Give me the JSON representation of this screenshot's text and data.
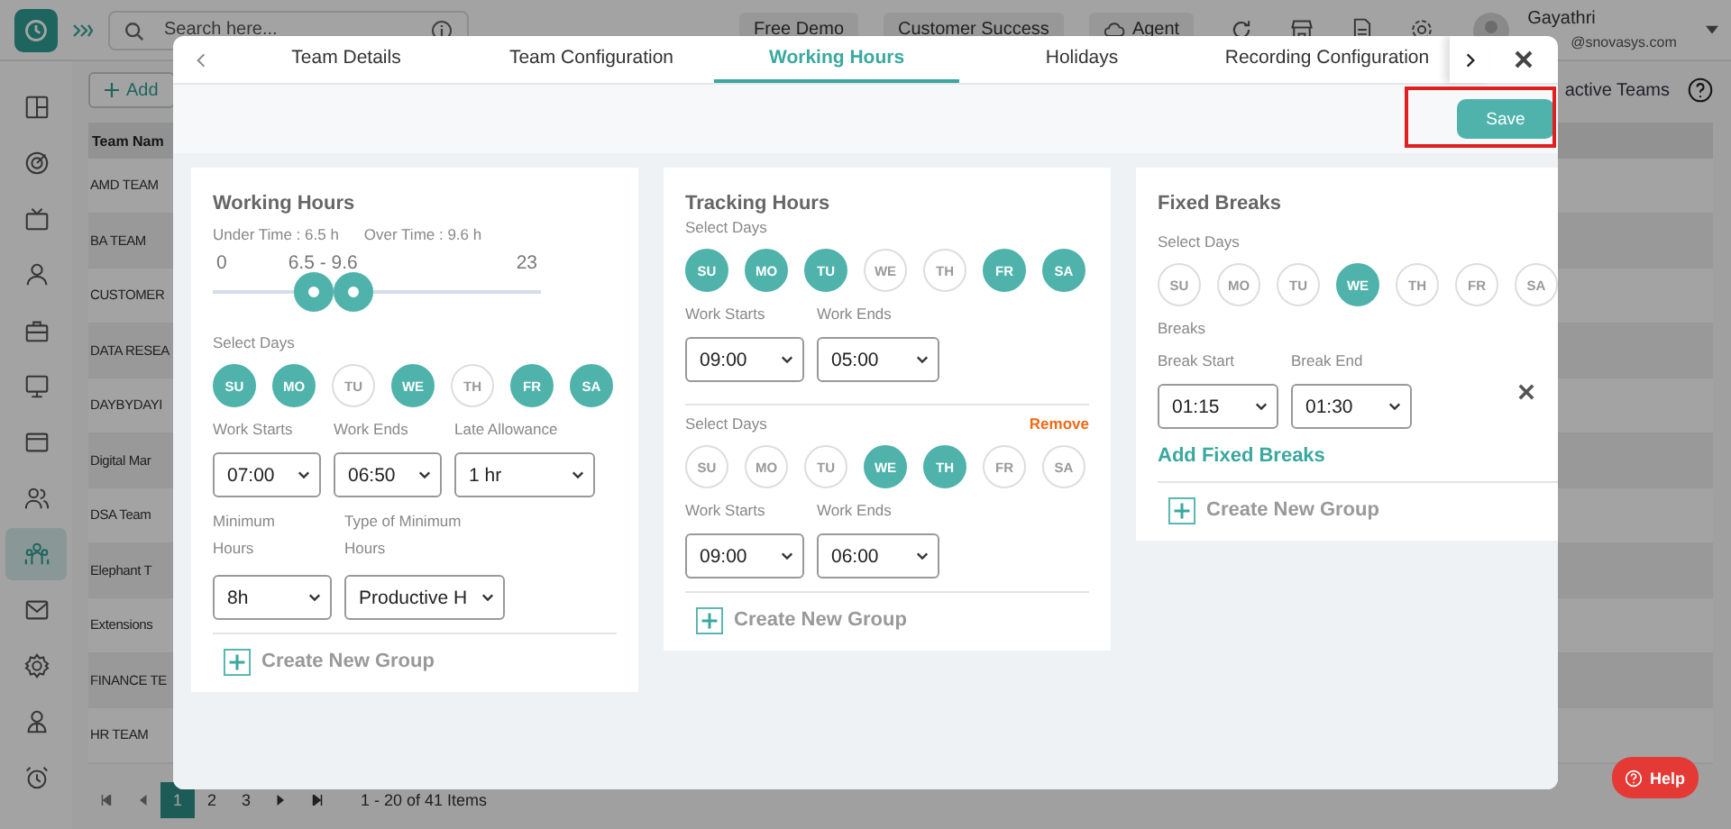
{
  "header": {
    "search": {
      "placeholder": "Search here..."
    },
    "buttons": [
      {
        "label": "Free Demo",
        "kind": "plain"
      },
      {
        "label": "Customer Success",
        "kind": "plain"
      },
      {
        "label": "Agent",
        "kind": "cloud"
      }
    ],
    "user": {
      "name": "Gayathri",
      "email": "@snovasys.com"
    }
  },
  "sidebar": {
    "items": [
      {
        "selected": false
      },
      {
        "selected": false
      },
      {
        "selected": false
      },
      {
        "selected": false
      },
      {
        "selected": false
      },
      {
        "selected": false
      },
      {
        "selected": false
      },
      {
        "selected": false
      },
      {
        "selected": true
      },
      {
        "selected": false
      },
      {
        "selected": false
      },
      {
        "selected": false
      },
      {
        "selected": false
      }
    ]
  },
  "page": {
    "add_button": "Add",
    "link": "active Teams",
    "table": {
      "columns": [
        "Team Nam"
      ],
      "rows": [
        "AMD TEAM",
        "BA TEAM",
        "CUSTOMER",
        "DATA RESEA",
        "DAYBYDAYI",
        "Digital Mar",
        "DSA Team",
        "Elephant T",
        "Extensions",
        "FINANCE TE",
        "HR TEAM"
      ]
    },
    "pagination": {
      "pages": [
        {
          "label": "1",
          "selected": true
        },
        {
          "label": "2",
          "selected": false
        },
        {
          "label": "3",
          "selected": false
        }
      ],
      "summary": "1 - 20 of 41 Items"
    }
  },
  "help_button": "Help",
  "modal": {
    "tabs": [
      {
        "label": "Team Details",
        "selected": false
      },
      {
        "label": "Team Configuration",
        "selected": false
      },
      {
        "label": "Working Hours",
        "selected": true
      },
      {
        "label": "Holidays",
        "selected": false
      },
      {
        "label": "Recording Configuration",
        "selected": false
      }
    ],
    "save_button": {
      "label": "Save",
      "highlighted": true
    },
    "cards": [
      {
        "title": "Working Hours",
        "times": [
          "Under Time : 6.5 h",
          "Over Time : 9.6 h"
        ],
        "slider": {
          "min": "0",
          "range": "6.5 - 9.6",
          "max": "23",
          "thumbs": [
            {
              "level": 0.31
            },
            {
              "level": 0.43
            }
          ]
        },
        "groups": [
          {
            "days_label": "Select Days",
            "days": [
              {
                "label": "SU",
                "selected": true
              },
              {
                "label": "MO",
                "selected": true
              },
              {
                "label": "TU",
                "selected": false
              },
              {
                "label": "WE",
                "selected": true
              },
              {
                "label": "TH",
                "selected": false
              },
              {
                "label": "FR",
                "selected": true
              },
              {
                "label": "SA",
                "selected": true
              }
            ],
            "field_rows": [
              [
                {
                  "label": "Work Starts",
                  "value": "07:00"
                },
                {
                  "label": "Work Ends",
                  "value": "06:50"
                },
                {
                  "label": "Late Allowance",
                  "value": "1 hr"
                }
              ],
              [
                {
                  "label": "Minimum Hours",
                  "value": "8h"
                },
                {
                  "label": "Type of Minimum Hours",
                  "value": "Productive H"
                }
              ]
            ]
          }
        ],
        "create_group": "Create New Group"
      },
      {
        "title": "Tracking Hours",
        "groups": [
          {
            "days_label": "Select Days",
            "days": [
              {
                "label": "SU",
                "selected": true
              },
              {
                "label": "MO",
                "selected": true
              },
              {
                "label": "TU",
                "selected": true
              },
              {
                "label": "WE",
                "selected": false
              },
              {
                "label": "TH",
                "selected": false
              },
              {
                "label": "FR",
                "selected": true
              },
              {
                "label": "SA",
                "selected": true
              }
            ],
            "field_rows": [
              [
                {
                  "label": "Work Starts",
                  "value": "09:00"
                },
                {
                  "label": "Work Ends",
                  "value": "05:00"
                }
              ]
            ]
          },
          {
            "days_label": "Select Days",
            "remove": "Remove",
            "days": [
              {
                "label": "SU",
                "selected": false
              },
              {
                "label": "MO",
                "selected": false
              },
              {
                "label": "TU",
                "selected": false
              },
              {
                "label": "WE",
                "selected": true
              },
              {
                "label": "TH",
                "selected": true
              },
              {
                "label": "FR",
                "selected": false
              },
              {
                "label": "SA",
                "selected": false
              }
            ],
            "field_rows": [
              [
                {
                  "label": "Work Starts",
                  "value": "09:00"
                },
                {
                  "label": "Work Ends",
                  "value": "06:00"
                }
              ]
            ]
          }
        ],
        "create_group": "Create New Group"
      },
      {
        "title": "Fixed Breaks",
        "groups": [
          {
            "days_label": "Select Days",
            "days": [
              {
                "label": "SU",
                "selected": false
              },
              {
                "label": "MO",
                "selected": false
              },
              {
                "label": "TU",
                "selected": false
              },
              {
                "label": "WE",
                "selected": true
              },
              {
                "label": "TH",
                "selected": false
              },
              {
                "label": "FR",
                "selected": false
              },
              {
                "label": "SA",
                "selected": false
              }
            ],
            "breaks_label": "Breaks",
            "deletable": true,
            "field_rows": [
              [
                {
                  "label": "Break Start",
                  "value": "01:15"
                },
                {
                  "label": "Break End",
                  "value": "01:30"
                }
              ]
            ]
          }
        ],
        "add_link": "Add Fixed Breaks",
        "create_group": "Create New Group"
      }
    ]
  }
}
